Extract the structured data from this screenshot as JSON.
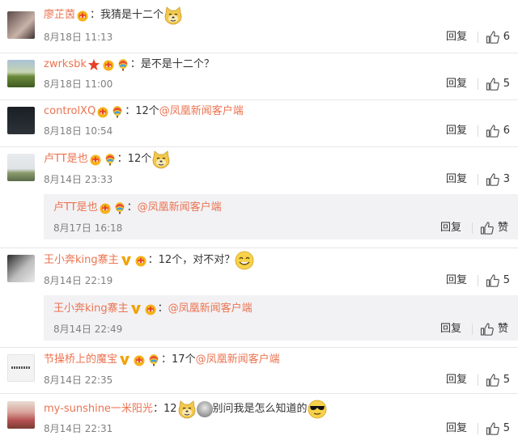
{
  "comments": [
    {
      "user": "廖芷茵",
      "sep": "：",
      "text": "我猜是十二个",
      "mention": "",
      "time": "8月18日 11:13",
      "reply": "回复",
      "likes": "6"
    },
    {
      "user": "zwrksbk",
      "sep": "：",
      "text": "是不是十二个？",
      "mention": "",
      "time": "8月18日 11:00",
      "reply": "回复",
      "likes": "5"
    },
    {
      "user": "controlXQ",
      "sep": "：",
      "text": "12个",
      "mention": "@凤凰新闻客户端",
      "time": "8月18日 10:54",
      "reply": "回复",
      "likes": "6"
    },
    {
      "user": "卢TT是也",
      "sep": "：",
      "text": "12个",
      "mention": "",
      "time": "8月14日 23:33",
      "reply": "回复",
      "likes": "3"
    },
    {
      "user": "王小奔king寨主",
      "sep": "：",
      "text": "12个，对不对？",
      "mention": "",
      "time": "8月14日 22:19",
      "reply": "回复",
      "likes": "5"
    },
    {
      "user": "节操桥上的魔宝",
      "sep": "：",
      "text": "17个",
      "mention": "@凤凰新闻客户端",
      "time": "8月14日 22:35",
      "reply": "回复",
      "likes": "5"
    },
    {
      "user": "my-sunshine一米阳光",
      "sep": "：",
      "text": "12",
      "text2": "别问我是怎么知道的",
      "mention": "",
      "time": "8月14日 22:31",
      "reply": "回复",
      "likes": "5"
    }
  ],
  "subreplies": [
    {
      "user": "卢TT是也",
      "sep": "：",
      "mention": "@凤凰新闻客户端",
      "time": "8月17日 16:18",
      "reply": "回复",
      "likes": "赞"
    },
    {
      "user": "王小奔king寨主",
      "sep": "：",
      "mention": "@凤凰新闻客户端",
      "time": "8月14日 22:49",
      "reply": "回复",
      "likes": "赞"
    }
  ],
  "colors": {
    "name": "#eb7350",
    "text": "#333333",
    "time": "#808080",
    "subbox": "#f2f2f5"
  },
  "icons": {
    "like": "thumbs-up-icon",
    "crown_badge": "vip-crown-icon",
    "balloon_badge": "balloon-icon",
    "verify_badge": "v-verified-icon",
    "star_badge": "star-icon",
    "dog_emoji": "doge-emoji",
    "smile_emoji": "smile-emoji",
    "shades_emoji": "sunglasses-emoji"
  }
}
